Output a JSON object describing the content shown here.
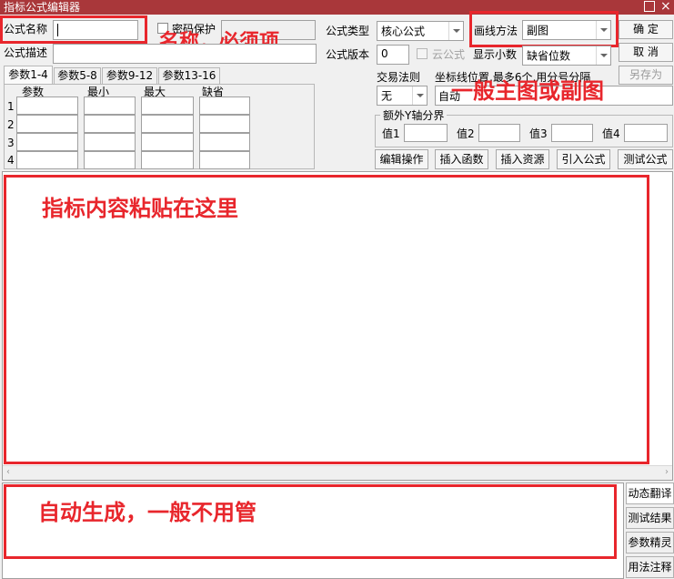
{
  "window": {
    "title": "指标公式编辑器"
  },
  "form": {
    "name_label": "公式名称",
    "name_value": "",
    "password_label": "密码保护",
    "desc_label": "公式描述",
    "type_label": "公式类型",
    "type_value": "核心公式",
    "draw_label": "画线方法",
    "draw_value": "副图",
    "version_label": "公式版本",
    "version_value": "0",
    "cloud_label": "云公式",
    "decimals_label": "显示小数",
    "decimals_value": "缺省位数",
    "trade_label": "交易法则",
    "trade_value": "无",
    "coord_label": "坐标线位置,最多6个,用分号分隔",
    "coord_value": "自动",
    "yaxis_label": "额外Y轴分界",
    "values": [
      "值1",
      "值2",
      "值3",
      "值4"
    ]
  },
  "buttons": {
    "ok": "确  定",
    "cancel": "取  消",
    "saveas": "另存为",
    "edit_op": "编辑操作",
    "insert_func": "插入函数",
    "insert_res": "插入资源",
    "import": "引入公式",
    "test": "测试公式"
  },
  "param_tabs": [
    "参数1-4",
    "参数5-8",
    "参数9-12",
    "参数13-16"
  ],
  "param_headers": [
    "参数",
    "最小",
    "最大",
    "缺省"
  ],
  "param_rows": [
    "1",
    "2",
    "3",
    "4"
  ],
  "side_tabs": [
    "动态翻译",
    "测试结果",
    "参数精灵",
    "用法注释"
  ],
  "annotations": {
    "name": "名称，必须项",
    "draw": "一般主图或副图",
    "content": "指标内容粘贴在这里",
    "auto": "自动生成，一般不用管"
  },
  "colors": {
    "title_bar": "#a9373a",
    "annotation_red": "#e8262c"
  }
}
